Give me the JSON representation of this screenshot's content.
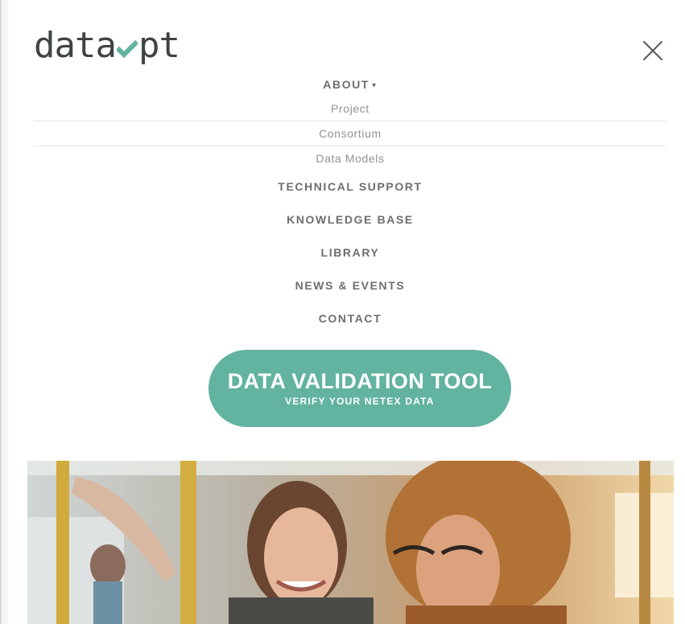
{
  "brand": {
    "logo_left": "data",
    "logo_right": "pt",
    "accent_color": "#62b3a0",
    "logo_color": "#3f4346"
  },
  "icons": {
    "close": "close-icon",
    "caret": "caret-down-icon"
  },
  "nav": {
    "about": {
      "label": "ABOUT",
      "caret": "▾"
    },
    "submenu": [
      "Project",
      "Consortium",
      "Data Models"
    ],
    "items": [
      "TECHNICAL SUPPORT",
      "KNOWLEDGE BASE",
      "LIBRARY",
      "NEWS & EVENTS",
      "CONTACT"
    ]
  },
  "cta": {
    "title": "DATA VALIDATION TOOL",
    "subtitle": "VERIFY YOUR NETEX DATA"
  },
  "hero": {
    "alt": "photo-people-on-bus"
  }
}
